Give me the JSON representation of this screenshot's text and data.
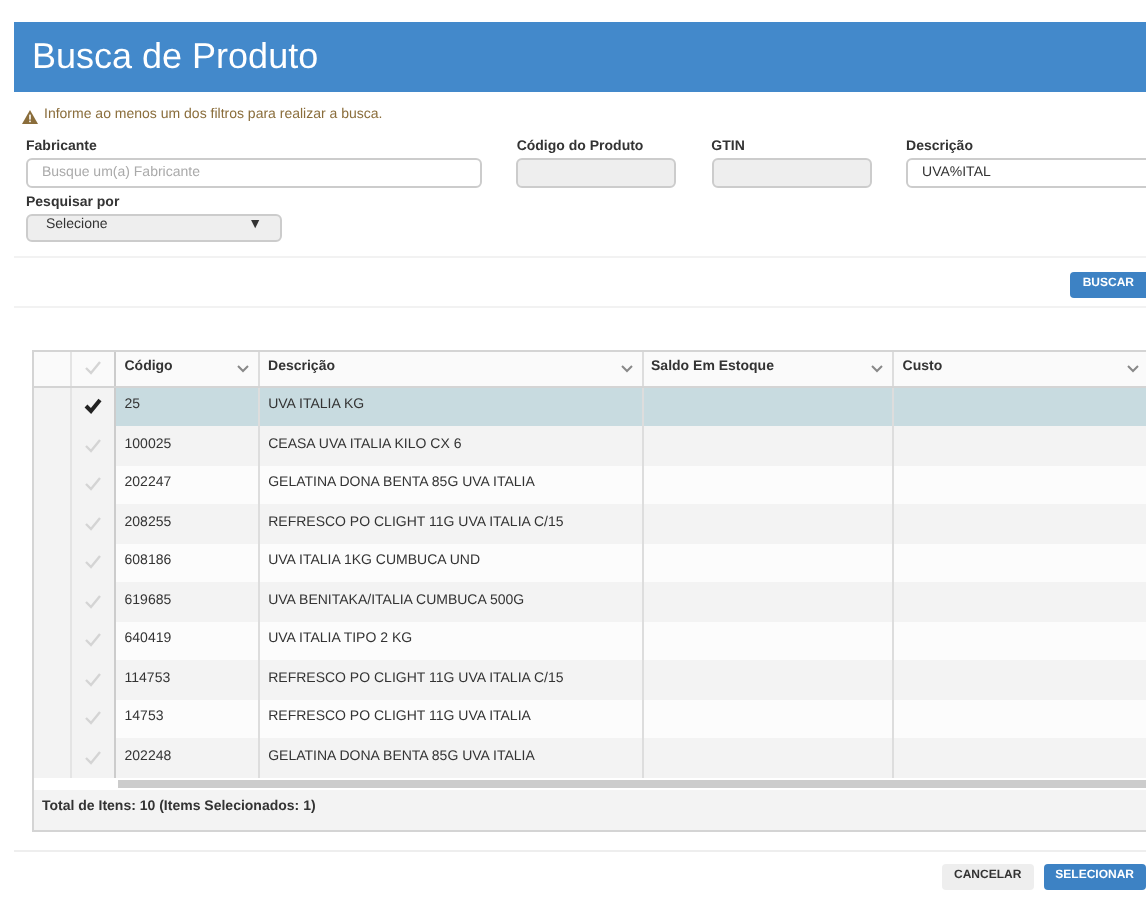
{
  "title": "Busca de Produto",
  "warning": "Informe ao menos um dos filtros para realizar a busca.",
  "fields": [
    {
      "label": "Fabricante",
      "placeholder": "Busque um(a) Fabricante",
      "disabled": false
    },
    {
      "label": "Código do Produto",
      "disabled": true
    },
    {
      "label": "GTIN",
      "disabled": true
    },
    {
      "label": "Descrição",
      "value": "UVA%ITAL",
      "disabled": false
    }
  ],
  "search_by": {
    "label": "Pesquisar por",
    "value": "Selecione",
    "arrow": "▼"
  },
  "search_button": "BUSCAR",
  "table": {
    "columns": [
      "Código",
      "Descrição",
      "Saldo Em Estoque",
      "Custo"
    ],
    "rows": [
      {
        "code": "25",
        "description": "UVA ITALIA KG",
        "selected": true
      },
      {
        "code": "100025",
        "description": "CEASA UVA ITALIA KILO CX 6",
        "selected": false
      },
      {
        "code": "202247",
        "description": "GELATINA DONA BENTA 85G UVA ITALIA",
        "selected": false
      },
      {
        "code": "208255",
        "description": "REFRESCO PO CLIGHT 11G UVA ITALIA C/15",
        "selected": false
      },
      {
        "code": "608186",
        "description": "UVA ITALIA 1KG CUMBUCA UND",
        "selected": false
      },
      {
        "code": "619685",
        "description": "UVA BENITAKA/ITALIA CUMBUCA 500G",
        "selected": false
      },
      {
        "code": "640419",
        "description": "UVA ITALIA TIPO 2 KG",
        "selected": false
      },
      {
        "code": "114753",
        "description": "REFRESCO PO CLIGHT 11G UVA ITALIA C/15",
        "selected": false
      },
      {
        "code": "14753",
        "description": "REFRESCO PO CLIGHT 11G UVA ITALIA",
        "selected": false
      },
      {
        "code": "202248",
        "description": "GELATINA DONA BENTA 85G UVA ITALIA",
        "selected": false
      }
    ],
    "footer": "Total de Itens: 10 (Items Selecionados: 1)"
  },
  "buttons": [
    {
      "label": "CANCELAR",
      "kind": "secondary"
    },
    {
      "label": "SELECIONAR",
      "kind": "primary"
    }
  ]
}
